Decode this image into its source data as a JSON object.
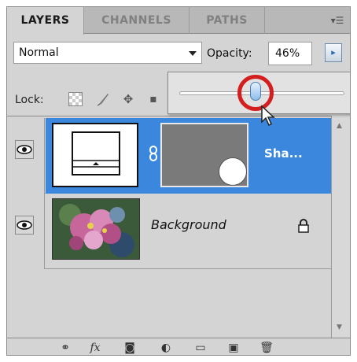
{
  "tabs": [
    "LAYERS",
    "CHANNELS",
    "PATHS"
  ],
  "blend_mode": {
    "value": "Normal"
  },
  "opacity": {
    "label": "Opacity:",
    "value": "46%",
    "slider_percent": 46
  },
  "lock": {
    "label": "Lock:"
  },
  "layers": [
    {
      "name": "Sha...",
      "selected": true,
      "visible": true
    },
    {
      "name": "Background",
      "selected": false,
      "visible": true,
      "locked": true
    }
  ],
  "toolbar": {
    "fx_label": "fx"
  },
  "colors": {
    "selection": "#3a87dd",
    "highlight_ring": "#d31f1f",
    "panel_bg": "#d4d4d4"
  }
}
